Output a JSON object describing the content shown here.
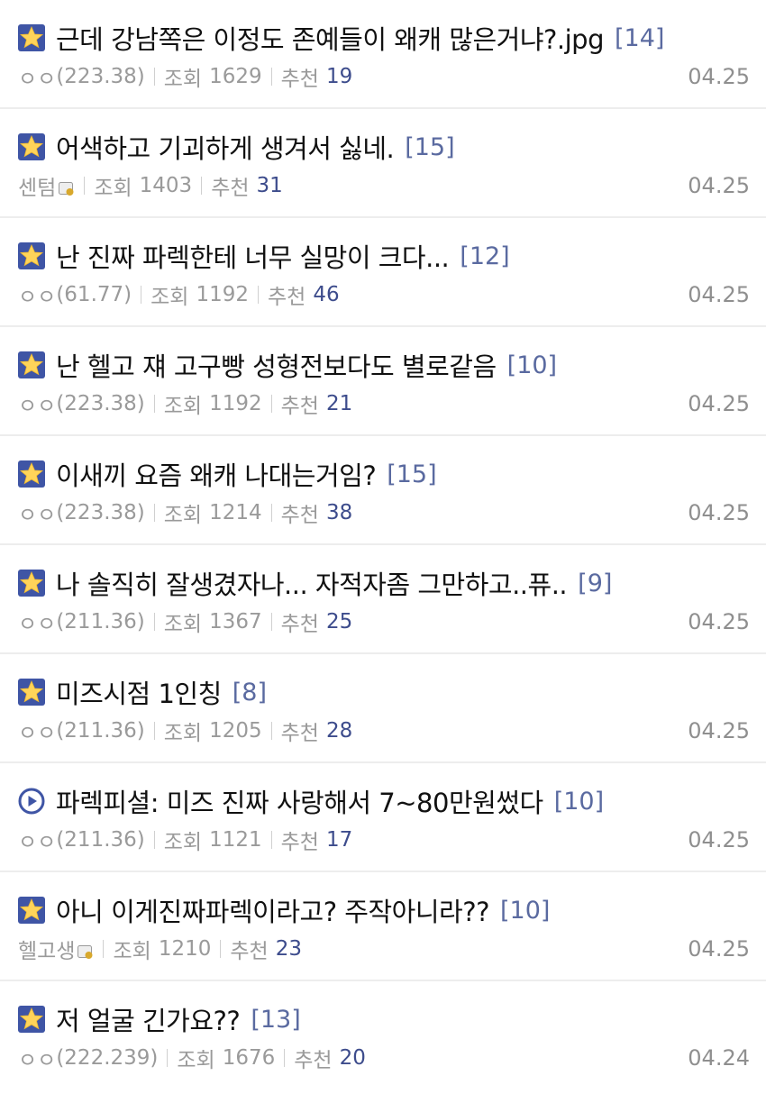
{
  "posts": [
    {
      "title": "근데 강남쪽은 이정도 존예들이 왜캐 많은거냐?.jpg",
      "comments": "[14]",
      "author": "ㅇㅇ",
      "ip": "(223.38)",
      "views_label": "조회",
      "views": "1629",
      "likes_label": "추천",
      "likes": "19",
      "date": "04.25",
      "icon": "star-icon"
    },
    {
      "title": "어색하고 기괴하게 생겨서 싫네.",
      "comments": "[15]",
      "author": "센텀",
      "ip": "",
      "views_label": "조회",
      "views": "1403",
      "likes_label": "추천",
      "likes": "31",
      "date": "04.25",
      "icon": "star-icon"
    },
    {
      "title": "난 진짜 파렉한테 너무 실망이 크다...",
      "comments": "[12]",
      "author": "ㅇㅇ",
      "ip": "(61.77)",
      "views_label": "조회",
      "views": "1192",
      "likes_label": "추천",
      "likes": "46",
      "date": "04.25",
      "icon": "star-icon"
    },
    {
      "title": "난 헬고 쟤 고구빵 성형전보다도 별로같음",
      "comments": "[10]",
      "author": "ㅇㅇ",
      "ip": "(223.38)",
      "views_label": "조회",
      "views": "1192",
      "likes_label": "추천",
      "likes": "21",
      "date": "04.25",
      "icon": "star-icon"
    },
    {
      "title": "이새끼 요즘 왜캐 나대는거임?",
      "comments": "[15]",
      "author": "ㅇㅇ",
      "ip": "(223.38)",
      "views_label": "조회",
      "views": "1214",
      "likes_label": "추천",
      "likes": "38",
      "date": "04.25",
      "icon": "star-icon"
    },
    {
      "title": "나 솔직히 잘생겼자나... 자적자좀 그만하고..퓨..",
      "comments": "[9]",
      "author": "ㅇㅇ",
      "ip": "(211.36)",
      "views_label": "조회",
      "views": "1367",
      "likes_label": "추천",
      "likes": "25",
      "date": "04.25",
      "icon": "star-icon"
    },
    {
      "title": "미즈시점 1인칭",
      "comments": "[8]",
      "author": "ㅇㅇ",
      "ip": "(211.36)",
      "views_label": "조회",
      "views": "1205",
      "likes_label": "추천",
      "likes": "28",
      "date": "04.25",
      "icon": "star-icon"
    },
    {
      "title": "파렉피셜: 미즈 진짜 사랑해서 7~80만원썼다",
      "comments": "[10]",
      "author": "ㅇㅇ",
      "ip": "(211.36)",
      "views_label": "조회",
      "views": "1121",
      "likes_label": "추천",
      "likes": "17",
      "date": "04.25",
      "icon": "play-icon"
    },
    {
      "title": "아니 이게진짜파렉이라고? 주작아니라??",
      "comments": "[10]",
      "author": "헬고생",
      "ip": "",
      "views_label": "조회",
      "views": "1210",
      "likes_label": "추천",
      "likes": "23",
      "date": "04.25",
      "icon": "star-icon"
    },
    {
      "title": "저 얼굴 긴가요??",
      "comments": "[13]",
      "author": "ㅇㅇ",
      "ip": "(222.239)",
      "views_label": "조회",
      "views": "1676",
      "likes_label": "추천",
      "likes": "20",
      "date": "04.24",
      "icon": "star-icon"
    }
  ]
}
